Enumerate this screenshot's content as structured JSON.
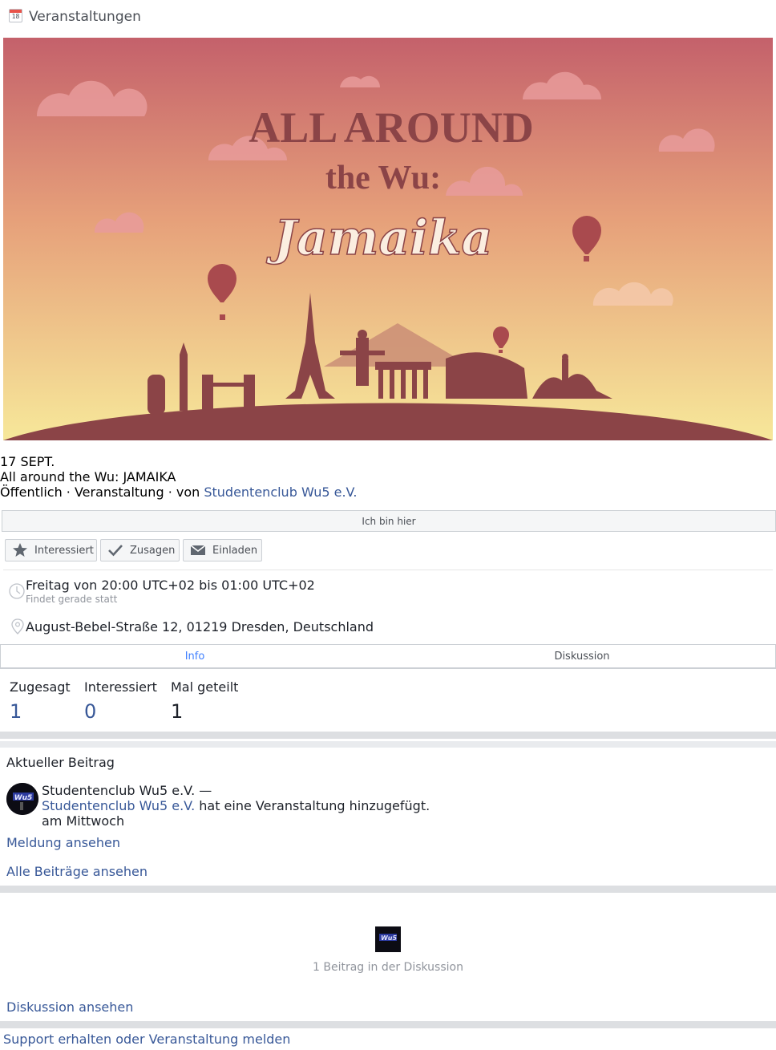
{
  "header": {
    "icon_day": "18",
    "title": "Veranstaltungen"
  },
  "cover": {
    "line1": "ALL AROUND",
    "line2": "the Wu:",
    "line3": "Jamaika"
  },
  "event": {
    "date": "17 SEPT.",
    "title": "All around the Wu: JAMAIKA",
    "meta_prefix": "Öffentlich · Veranstaltung · von ",
    "host": "Studentenclub Wu5 e.V."
  },
  "actions": {
    "im_here": "Ich bin hier",
    "interested": "Interessiert",
    "going": "Zusagen",
    "invite": "Einladen"
  },
  "details": {
    "time": "Freitag von 20:00 UTC+02 bis 01:00 UTC+02",
    "time_status": "Findet gerade statt",
    "location": "August-Bebel-Straße 12, 01219 Dresden, Deutschland"
  },
  "tabs": {
    "info": "Info",
    "discussion": "Diskussion"
  },
  "stats": {
    "going_label": "Zugesagt",
    "going_value": "1",
    "interested_label": "Interessiert",
    "interested_value": "0",
    "shared_label": "Mal geteilt",
    "shared_value": "1"
  },
  "recent": {
    "title": "Aktueller Beitrag",
    "author_line": "Studentenclub Wu5 e.V. —",
    "author_link": "Studentenclub Wu5 e.V.",
    "action_text": " hat eine Veranstaltung hinzugefügt.",
    "when": "am Mittwoch",
    "view_report": "Meldung ansehen",
    "all_posts": "Alle Beiträge ansehen",
    "avatar_text": "Wu5"
  },
  "discussion": {
    "thumb_text": "Wu5",
    "count_text": "1 Beitrag in der Diskussion",
    "view": "Diskussion ansehen"
  },
  "footer": {
    "support": "Support erhalten oder Veranstaltung melden"
  },
  "colors": {
    "link": "#385898",
    "tab_active": "#4080ff",
    "cover_top": "#c4616b",
    "cover_bottom": "#f7e89a",
    "silhouette": "#8b4447"
  }
}
